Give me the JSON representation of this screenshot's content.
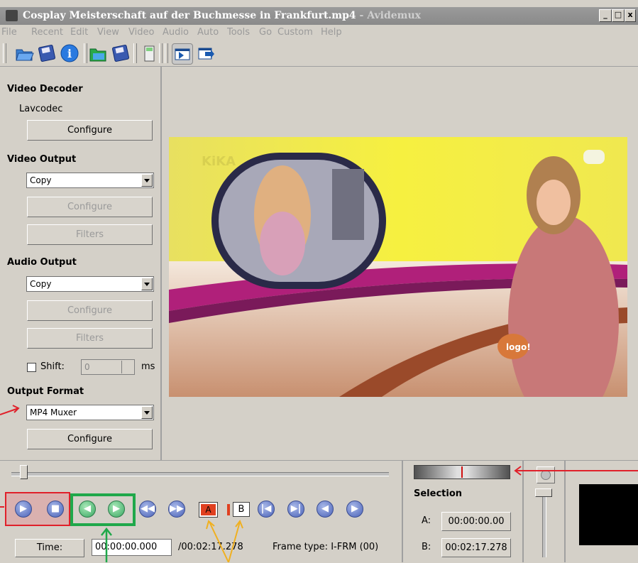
{
  "window": {
    "title_main": "Cosplay Meisterschaft auf der Buchmesse in Frankfurt.mp4",
    "title_app": " - Avidemux",
    "controls": {
      "minimize": "_",
      "maximize": "□",
      "close": "x"
    }
  },
  "menu": [
    "File",
    "Recent",
    "Edit",
    "View",
    "Video",
    "Audio",
    "Auto",
    "Tools",
    "Go",
    "Custom",
    "Help"
  ],
  "toolbar": {
    "icons": [
      "open-icon",
      "save-icon",
      "info-icon",
      "open-video-icon",
      "save-video-icon",
      "calculator-icon",
      "display-input-icon",
      "display-output-icon"
    ]
  },
  "left": {
    "video_decoder": {
      "heading": "Video Decoder",
      "codec": "Lavcodec",
      "configure": "Configure"
    },
    "video_output": {
      "heading": "Video Output",
      "value": "Copy",
      "configure": "Configure",
      "filters": "Filters"
    },
    "audio_output": {
      "heading": "Audio Output",
      "value": "Copy",
      "configure": "Configure",
      "filters": "Filters"
    },
    "shift": {
      "label": "Shift:",
      "value": "0",
      "unit": "ms"
    },
    "output_format": {
      "heading": "Output Format",
      "value": "MP4 Muxer",
      "configure": "Configure"
    }
  },
  "video": {
    "channel_logo": "KiKA",
    "card_logo": "logo!"
  },
  "playback": {
    "time_button": "Time:",
    "current_time": "00:00:00.000",
    "total_time": "/00:02:17.278",
    "frame_type": "Frame type: I-FRM (00)",
    "marker_a": "A",
    "marker_b": "B",
    "position": 0
  },
  "selection": {
    "heading": "Selection",
    "a_label": "A:",
    "a_value": "00:00:00.00",
    "b_label": "B:",
    "b_value": "00:02:17.278"
  },
  "colors": {
    "highlight_red": "#e0202a",
    "highlight_green": "#1fa84a",
    "arrow_yellow": "#f0b020"
  }
}
